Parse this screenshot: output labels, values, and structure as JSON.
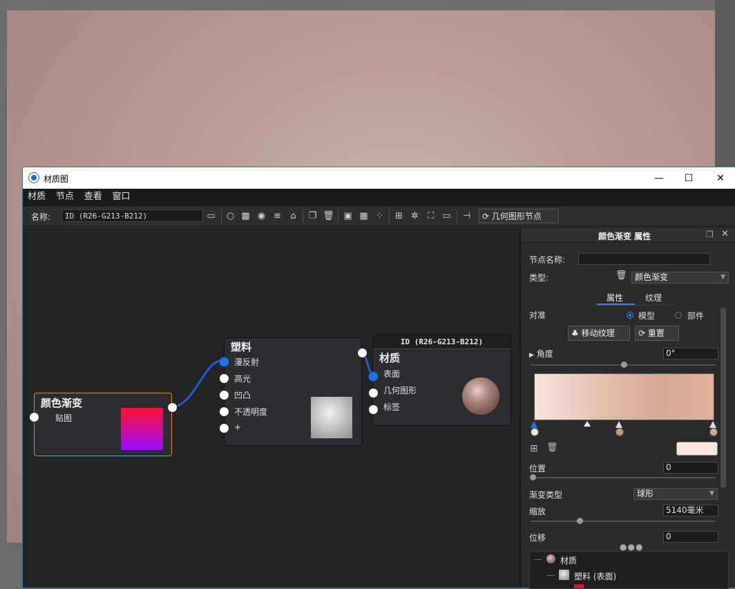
{
  "window": {
    "title": "材质图"
  },
  "menu": [
    "材质",
    "节点",
    "查看",
    "窗口"
  ],
  "toolbar": {
    "name_label": "名称:",
    "name_value": "ID (R26-G213-B212)",
    "geometry_button": "几何图形节点"
  },
  "nodes": {
    "gradient": {
      "title": "颜色渐变",
      "inputs": [
        "贴图"
      ],
      "preview_colors": [
        "#ff1030",
        "#9a0cff"
      ]
    },
    "plastic": {
      "title": "塑料",
      "inputs": [
        "漫反射",
        "高光",
        "凹凸",
        "不透明度",
        "+"
      ]
    },
    "material": {
      "header": "ID (R26-G213-B212)",
      "title": "材质",
      "inputs": [
        "表面",
        "几何图形",
        "标签"
      ]
    }
  },
  "panel": {
    "title": "颜色渐变 属性",
    "node_name_label": "节点名称:",
    "node_name_value": "",
    "type_label": "类型:",
    "type_value": "颜色渐变",
    "tabs": [
      "属性",
      "纹理"
    ],
    "align_label": "对准",
    "align_options": [
      "模型",
      "部件"
    ],
    "align_selected": "模型",
    "move_texture_button": "移动纹理",
    "reset_button": "重置",
    "angle_label": "角度",
    "angle_value": "0°",
    "gradient_colors": [
      "#f8e3da",
      "#e0b9a6",
      "#d5a995",
      "#e2b29e"
    ],
    "stop_color": "#f8e6dd",
    "position_label": "位置",
    "position_value": "0",
    "gradient_type_label": "渐变类型",
    "gradient_type_value": "球形",
    "scale_label": "缩放",
    "scale_value": "5140毫米",
    "offset_label": "位移",
    "offset_value": "0",
    "tree": [
      {
        "label": "材质"
      },
      {
        "label": "塑料 (表面)"
      }
    ]
  },
  "colors": {
    "accent": "#2173e8",
    "wire": "#1f5fd1",
    "node_selected_border": "#d58b2e"
  }
}
